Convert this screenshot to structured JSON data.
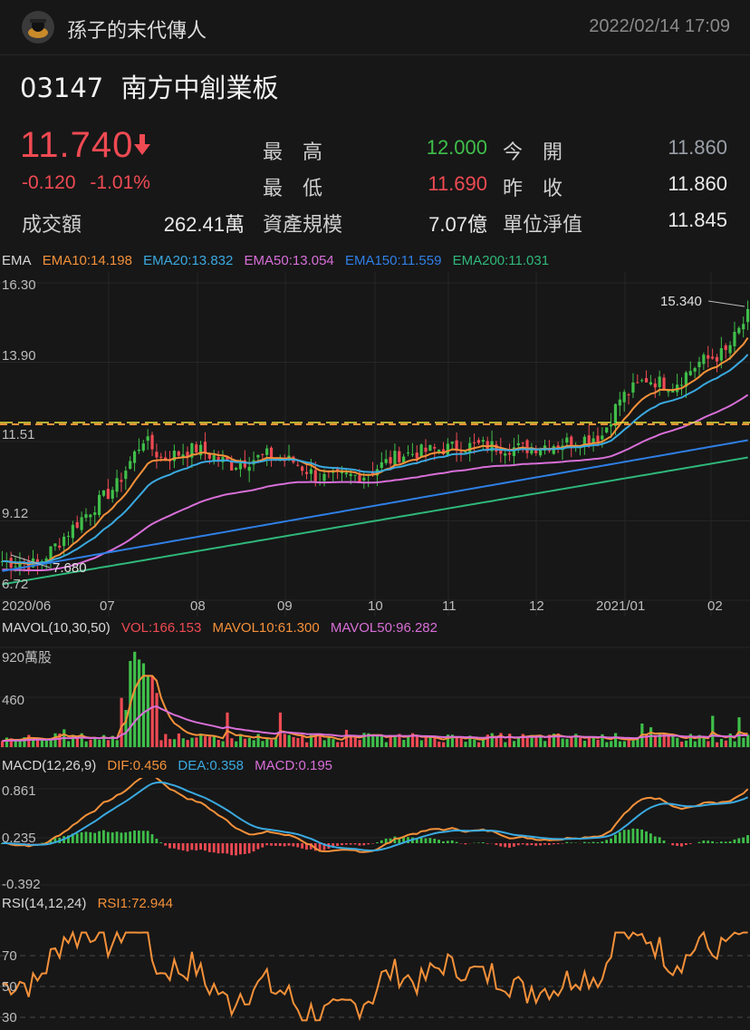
{
  "header": {
    "username": "孫子的末代傳人",
    "datetime": "2022/02/14 17:09"
  },
  "stock": {
    "code": "03147",
    "name": "南方中創業板"
  },
  "quote": {
    "price": "11.740",
    "change": "-0.120",
    "change_pct": "-1.01%",
    "turnover_label": "成交額",
    "turnover": "262.41萬",
    "high_label": "最　高",
    "high": "12.000",
    "low_label": "最　低",
    "low": "11.690",
    "aum_label": "資產規模",
    "aum": "7.07億",
    "open_label": "今　開",
    "open": "11.860",
    "prev_close_label": "昨　收",
    "prev_close": "11.860",
    "nav_label": "單位淨值",
    "nav": "11.845"
  },
  "colors": {
    "up": "#3fbf4a",
    "down": "#ef4a53",
    "ema10": "#f5913a",
    "ema20": "#3aa9e0",
    "ema50": "#d86fd8",
    "ema150": "#2f7fe6",
    "ema200": "#2fb87a"
  },
  "ema_panel": {
    "label": "EMA",
    "ema10": "EMA10:14.198",
    "ema20": "EMA20:13.832",
    "ema50": "EMA50:13.054",
    "ema150": "EMA150:11.559",
    "ema200": "EMA200:11.031",
    "y_ticks": [
      "16.30",
      "13.90",
      "11.51",
      "9.12",
      "6.72"
    ],
    "max_label": "15.340",
    "min_label": "7.680",
    "x_ticks": [
      "2020/06",
      "07",
      "08",
      "09",
      "10",
      "11",
      "12",
      "2021/01",
      "02"
    ]
  },
  "vol_panel": {
    "label": "MAVOL(10,30,50)",
    "vol": "VOL:166.153",
    "mavol10": "MAVOL10:61.300",
    "mavol50": "MAVOL50:96.282",
    "y_ticks": [
      "920萬股",
      "460"
    ]
  },
  "macd_panel": {
    "label": "MACD(12,26,9)",
    "dif": "DIF:0.456",
    "dea": "DEA:0.358",
    "macd": "MACD:0.195",
    "y_ticks": [
      "0.861",
      "0.235",
      "-0.392"
    ]
  },
  "rsi_panel": {
    "label": "RSI(14,12,24)",
    "rsi1": "RSI1:72.944",
    "y_ticks": [
      "70",
      "50",
      "30"
    ]
  }
}
